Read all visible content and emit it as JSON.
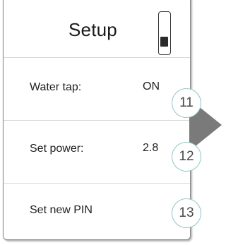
{
  "screen": {
    "title": "Setup"
  },
  "menu": {
    "items": [
      {
        "label": "Water tap:",
        "value": "ON",
        "callout": "11"
      },
      {
        "label": "Set power:",
        "value": "2.8",
        "callout": "12"
      },
      {
        "label": "Set new PIN",
        "value": "",
        "callout": "13"
      }
    ]
  },
  "colors": {
    "border": "#8a8a8a",
    "divider": "#d9d9d9",
    "callout_ring": "#8fc7c4",
    "pointer": "#7a7a7a"
  },
  "icons": [
    "scroll-indicator-icon",
    "pointer-arrow-icon"
  ]
}
